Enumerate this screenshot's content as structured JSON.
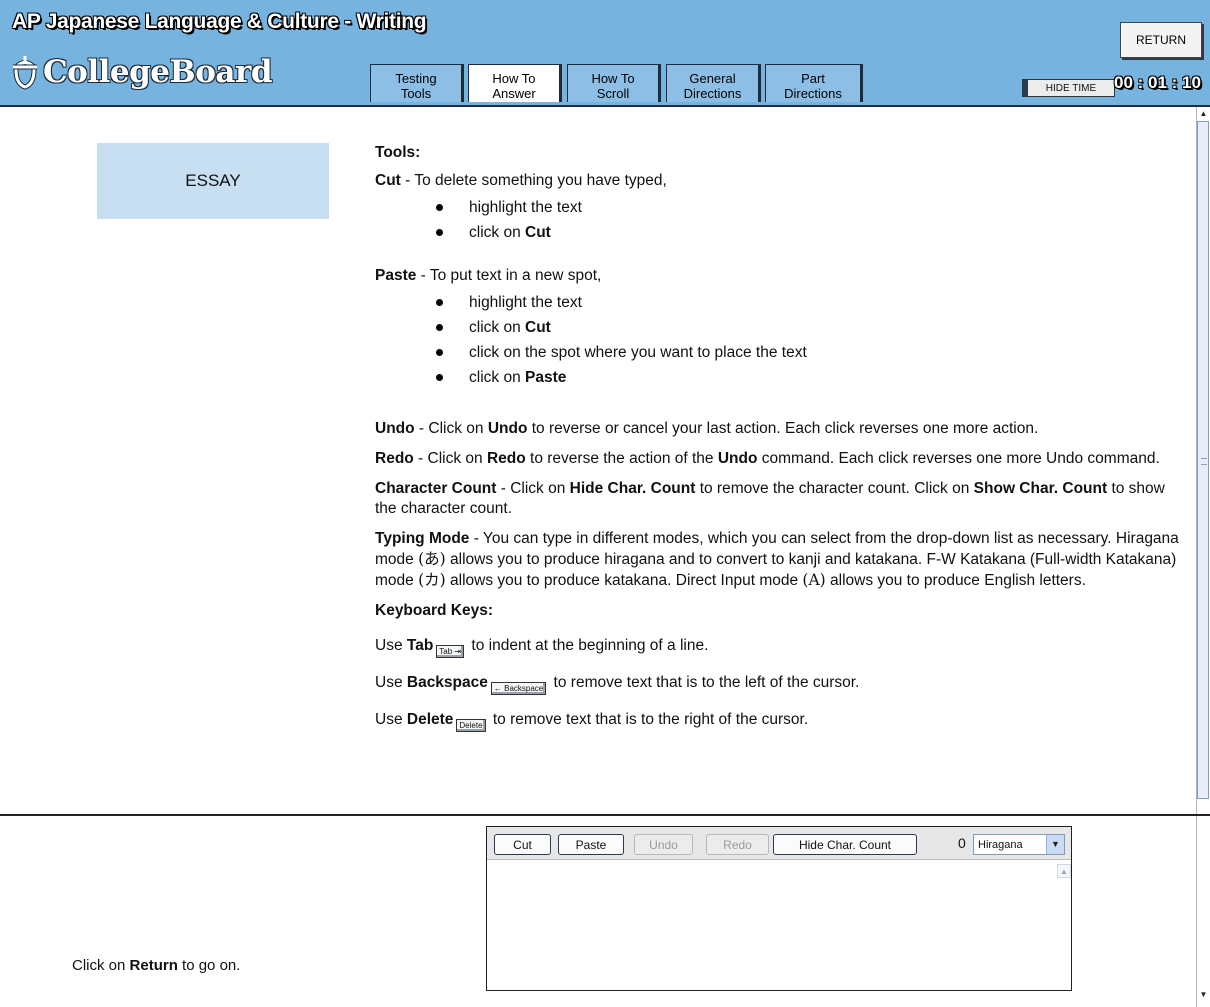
{
  "header": {
    "title": "AP Japanese Language & Culture - Writing",
    "logo_text": "CollegeBoard",
    "return_label": "RETURN",
    "tabs": [
      {
        "line1": "Testing",
        "line2": "Tools"
      },
      {
        "line1": "How To",
        "line2": "Answer"
      },
      {
        "line1": "How To",
        "line2": "Scroll"
      },
      {
        "line1": "General",
        "line2": "Directions"
      },
      {
        "line1": "Part",
        "line2": "Directions"
      }
    ],
    "active_tab": "How To Answer",
    "hide_time_label": "HIDE TIME",
    "timer": "00 : 01 : 10"
  },
  "content": {
    "section_label": "ESSAY",
    "tools_heading": "Tools:",
    "cut": {
      "term": "Cut",
      "desc": " - To delete something you have typed,",
      "steps": [
        "highlight the text",
        "click on "
      ],
      "step2_bold": "Cut"
    },
    "paste": {
      "term": "Paste",
      "desc": " - To put text in a new spot,",
      "step1": "highlight the text",
      "step2": "click on ",
      "step2_bold": "Cut",
      "step3": "click on the spot where you want to place the text",
      "step4": "click on ",
      "step4_bold": "Paste"
    },
    "undo": {
      "term": "Undo",
      "t1": " - Click on ",
      "b1": "Undo",
      "t2": " to reverse or cancel your last action. Each click reverses one more action."
    },
    "redo": {
      "term": "Redo",
      "t1": " - Click on ",
      "b1": "Redo",
      "t2": " to reverse the action of the ",
      "b2": "Undo",
      "t3": " command. Each click reverses one more Undo command."
    },
    "char_count": {
      "term": "Character Count",
      "t1": " - Click on ",
      "b1": "Hide Char. Count",
      "t2": " to remove the character count. Click on ",
      "b2": "Show Char. Count",
      "t3": " to show the character count."
    },
    "typing_mode": {
      "term": "Typing Mode",
      "t1": " - You can type in different modes, which you can select from the drop-down list as necessary. Hiragana mode ",
      "g1": "(あ)",
      "t2": " allows you to produce hiragana and to convert to kanji and katakana.  F-W Katakana (Full-width Katakana) mode ",
      "g2": "(カ)",
      "t3": " allows you to produce katakana.  Direct Input mode ",
      "g3": "(A)",
      "t4": " allows you to produce English letters."
    },
    "keyboard_heading": "Keyboard Keys:",
    "keys": [
      {
        "pre": "Use ",
        "key": "Tab",
        "cap": "Tab ⇥",
        "post": "  to indent at the beginning of a line."
      },
      {
        "pre": "Use ",
        "key": "Backspace",
        "cap": "← Backspace",
        "post": "  to remove text that is to the left of the cursor."
      },
      {
        "pre": "Use ",
        "key": "Delete",
        "cap": "Delete",
        "post": "  to remove text that is to the right of the cursor."
      }
    ]
  },
  "footer": {
    "msg_pre": "Click on ",
    "msg_bold": "Return",
    "msg_post": " to go on."
  },
  "editor": {
    "cut": "Cut",
    "paste": "Paste",
    "undo": "Undo",
    "redo": "Redo",
    "hide_char_count": "Hide Char. Count",
    "char_count": "0",
    "mode": "Hiragana"
  }
}
